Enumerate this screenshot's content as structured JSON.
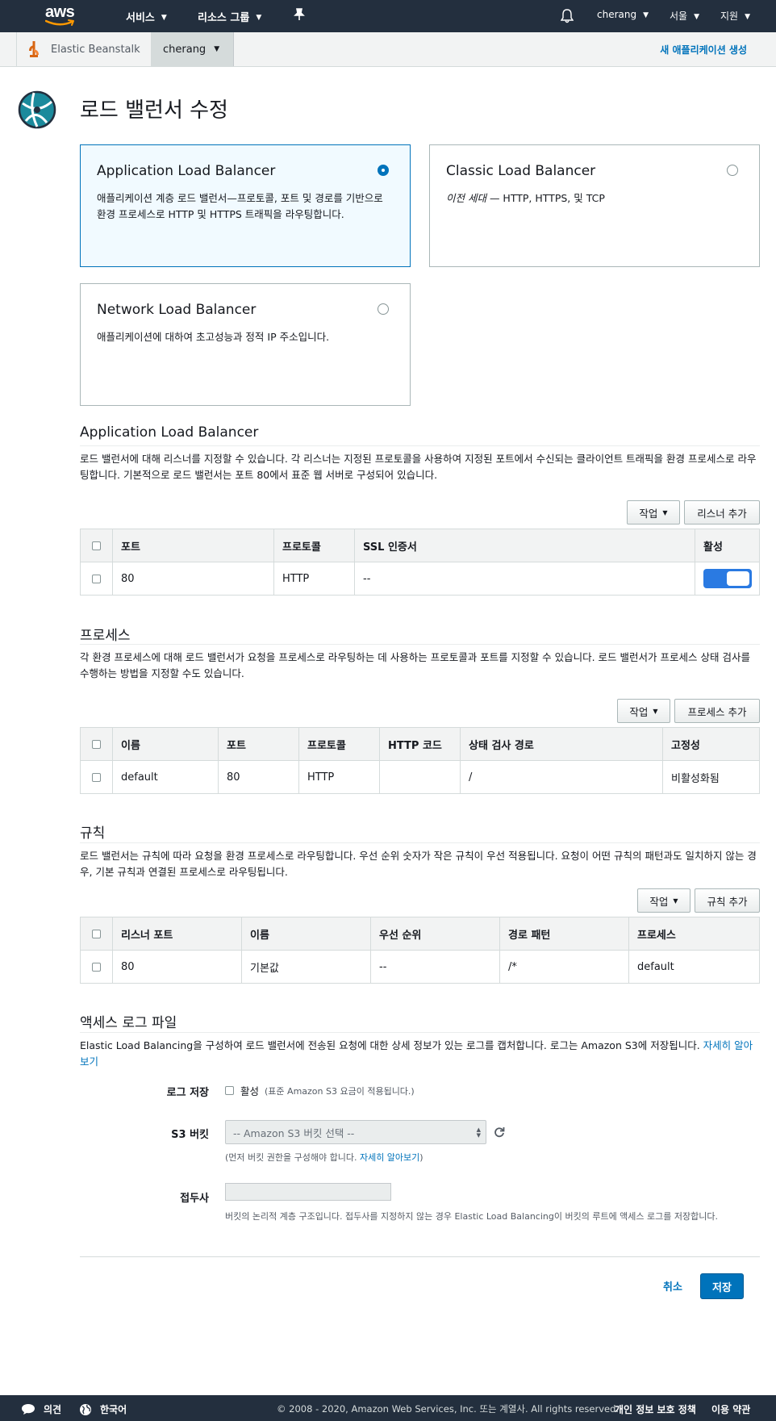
{
  "nav": {
    "logo_text": "aws",
    "services": "서비스",
    "resource_groups": "리소스 그룹",
    "user": "cherang",
    "region": "서울",
    "support": "지원"
  },
  "subheader": {
    "service": "Elastic Beanstalk",
    "environment": "cherang",
    "new_app": "새 애플리케이션 생성"
  },
  "page": {
    "title": "로드 밸런서 수정"
  },
  "lb_options": [
    {
      "title": "Application Load Balancer",
      "desc": "애플리케이션 계층 로드 밸런서—프로토콜, 포트 및 경로를 기반으로 환경 프로세스로 HTTP 및 HTTPS 트래픽을 라우팅합니다.",
      "selected": true
    },
    {
      "title": "Classic Load Balancer",
      "desc_em": "이전 세대",
      "desc_rest": " — HTTP, HTTPS, 및 TCP",
      "selected": false
    },
    {
      "title": "Network Load Balancer",
      "desc": "애플리케이션에 대하여 초고성능과 정적 IP 주소입니다.",
      "selected": false
    }
  ],
  "listeners": {
    "title": "Application Load Balancer",
    "desc": "로드 밸런서에 대해 리스너를 지정할 수 있습니다. 각 리스너는 지정된 프로토콜을 사용하여 지정된 포트에서 수신되는 클라이언트 트래픽을 환경 프로세스로 라우팅합니다. 기본적으로 로드 밸런서는 포트 80에서 표준 웹 서버로 구성되어 있습니다.",
    "actions": "작업",
    "add": "리스너 추가",
    "columns": [
      "포트",
      "프로토콜",
      "SSL 인증서",
      "활성"
    ],
    "rows": [
      {
        "port": "80",
        "protocol": "HTTP",
        "ssl": "--",
        "enabled": true
      }
    ]
  },
  "processes": {
    "title": "프로세스",
    "desc": "각 환경 프로세스에 대해 로드 밸런서가 요청을 프로세스로 라우팅하는 데 사용하는 프로토콜과 포트를 지정할 수 있습니다. 로드 밸런서가 프로세스 상태 검사를 수행하는 방법을 지정할 수도 있습니다.",
    "actions": "작업",
    "add": "프로세스 추가",
    "columns": [
      "이름",
      "포트",
      "프로토콜",
      "HTTP 코드",
      "상태 검사 경로",
      "고정성"
    ],
    "rows": [
      {
        "name": "default",
        "port": "80",
        "protocol": "HTTP",
        "http_code": "",
        "health_path": "/",
        "stickiness": "비활성화됨"
      }
    ]
  },
  "rules": {
    "title": "규칙",
    "desc": "로드 밸런서는 규칙에 따라 요청을 환경 프로세스로 라우팅합니다. 우선 순위 숫자가 작은 규칙이 우선 적용됩니다. 요청이 어떤 규칙의 패턴과도 일치하지 않는 경우, 기본 규칙과 연결된 프로세스로 라우팅됩니다.",
    "actions": "작업",
    "add": "규칙 추가",
    "columns": [
      "리스너 포트",
      "이름",
      "우선 순위",
      "경로 패턴",
      "프로세스"
    ],
    "rows": [
      {
        "listener_port": "80",
        "name": "기본값",
        "priority": "--",
        "path": "/*",
        "process": "default"
      }
    ]
  },
  "access_logs": {
    "title": "액세스 로그 파일",
    "desc": "Elastic Load Balancing을 구성하여 로드 밸런서에 전송된 요청에 대한 상세 정보가 있는 로그를 캡처합니다. 로그는 Amazon S3에 저장됩니다.",
    "learn_more": "자세히 알아보기",
    "log_store_label": "로그 저장",
    "enable_label": "활성",
    "enable_hint": "(표준 Amazon S3 요금이 적용됩니다.)",
    "bucket_label": "S3 버킷",
    "bucket_placeholder": "-- Amazon S3 버킷 선택 --",
    "bucket_hint": "(먼저 버킷 권한을 구성해야 합니다. ",
    "bucket_hint_link": "자세히 알아보기",
    "bucket_hint_end": ")",
    "prefix_label": "접두사",
    "prefix_value": "",
    "prefix_hint": "버킷의 논리적 계층 구조입니다. 접두사를 지정하지 않는 경우 Elastic Load Balancing이 버킷의 루트에 액세스 로그를 저장합니다."
  },
  "actions": {
    "cancel": "취소",
    "save": "저장"
  },
  "footer": {
    "feedback": "의견",
    "language": "한국어",
    "copyright": "© 2008 - 2020, Amazon Web Services, Inc. 또는 계열사. All rights reserved.",
    "privacy": "개인 정보 보호 정책",
    "terms": "이용 약관"
  },
  "colors": {
    "nav_bg": "#232f3e",
    "accent": "#0073bb",
    "toggle": "#2a7ae2",
    "aws_orange": "#ff9900"
  }
}
